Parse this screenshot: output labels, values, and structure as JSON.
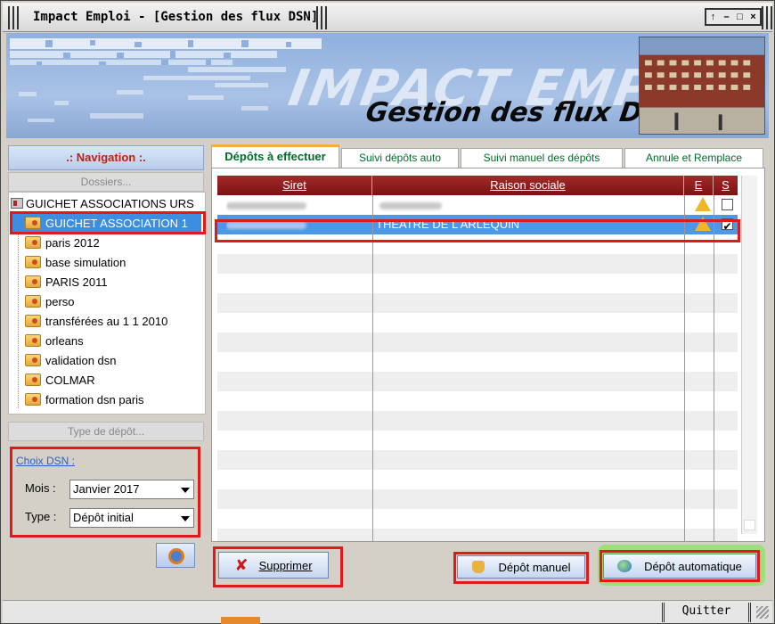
{
  "window": {
    "title": "Impact Emploi - [Gestion des flux DSN]",
    "controls": [
      "↑",
      "–",
      "□",
      "×"
    ]
  },
  "banner": {
    "brand": "IMPACT EMPLOI",
    "subtitle": "Gestion des flux DSN"
  },
  "navigation": {
    "header": ".: Navigation :.",
    "dossiers_label": "Dossiers...",
    "tree_root": "GUICHET ASSOCIATIONS URS",
    "tree_items": [
      {
        "label": "GUICHET ASSOCIATION 1",
        "selected": true
      },
      {
        "label": "paris 2012"
      },
      {
        "label": "base simulation"
      },
      {
        "label": "PARIS 2011"
      },
      {
        "label": "perso"
      },
      {
        "label": "transférées au 1 1 2010"
      },
      {
        "label": "orleans"
      },
      {
        "label": "validation dsn"
      },
      {
        "label": "COLMAR"
      },
      {
        "label": "formation dsn paris"
      }
    ],
    "type_depot_label": "Type de dépôt..."
  },
  "choix_dsn": {
    "link": "Choix DSN :",
    "mois_label": "Mois :",
    "mois_value": "Janvier 2017",
    "type_label": "Type :",
    "type_value": "Dépôt initial"
  },
  "tabs": [
    {
      "label": "Dépôts à effectuer",
      "active": true
    },
    {
      "label": "Suivi dépôts auto"
    },
    {
      "label": "Suivi manuel des dépôts"
    },
    {
      "label": "Annule et Remplace"
    }
  ],
  "grid": {
    "columns": [
      "Siret",
      "Raison sociale",
      "E",
      "S"
    ],
    "rows": [
      {
        "siret": "",
        "raison": "",
        "warning": true,
        "checked": false,
        "selected": false
      },
      {
        "siret": "",
        "raison": "THEATRE DE L ARLEQUIN",
        "warning": true,
        "checked": true,
        "selected": true
      }
    ]
  },
  "buttons": {
    "supprimer": "Supprimer",
    "depot_manuel": "Dépôt manuel",
    "depot_automatique": "Dépôt automatique",
    "quitter": "Quitter"
  },
  "colors": {
    "highlight": "#e01a1a",
    "header_red": "#8b1a1a",
    "selection_blue": "#4b98e6",
    "tab_green": "#006b2b"
  }
}
